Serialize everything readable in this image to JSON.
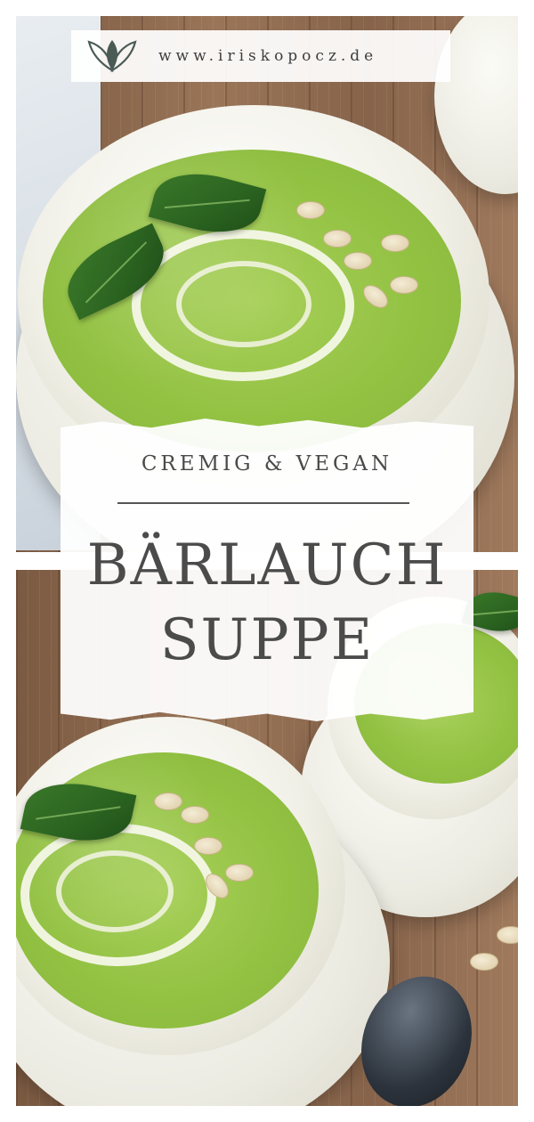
{
  "logo": {
    "url_text": "www.iriskopocz.de",
    "icon": "leaf-logo-icon"
  },
  "title_card": {
    "subtitle": "CREMIG & VEGAN",
    "title_line_1": "BÄRLAUCH",
    "title_line_2": "SUPPE"
  },
  "colors": {
    "soup_green": "#93c243",
    "basil_green": "#2a6220",
    "text_gray": "#4b4b4b",
    "bowl_white": "#f1f0e7"
  }
}
